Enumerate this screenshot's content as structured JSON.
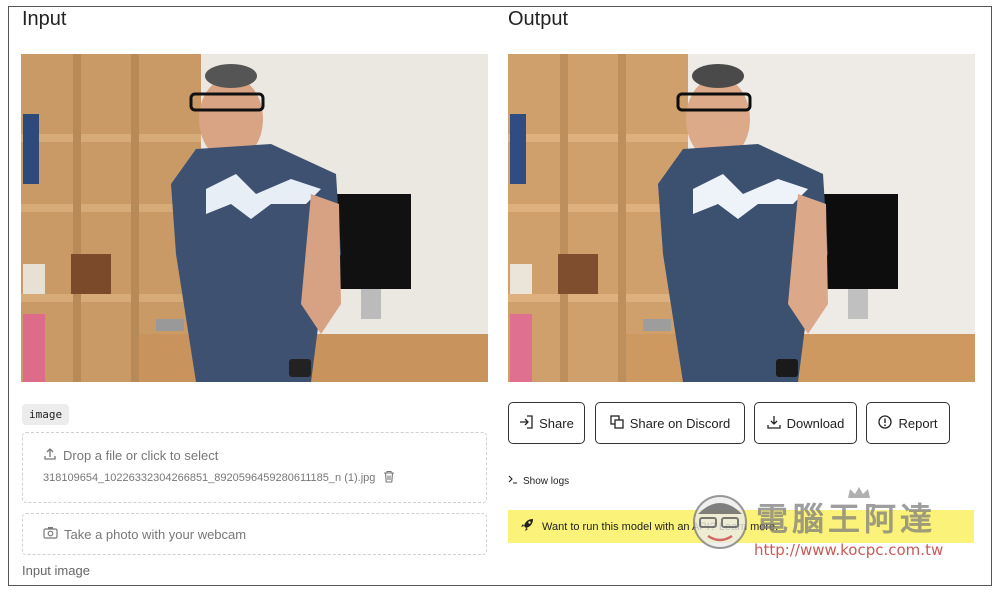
{
  "input": {
    "title": "Input",
    "type_tag": "image",
    "drop_text": "Drop a file or click to select",
    "file_name": "318109654_10226332304266851_8920596459280611185_n (1).jpg",
    "webcam_text": "Take a photo with your webcam",
    "caption": "Input image"
  },
  "output": {
    "title": "Output",
    "buttons": {
      "share": "Share",
      "discord": "Share on Discord",
      "download": "Download",
      "report": "Report"
    },
    "show_logs": "Show logs",
    "api_text": "Want to run this model with an API? Learn more."
  },
  "watermark": {
    "title": "電腦王阿達",
    "url": "http://www.kocpc.com.tw"
  },
  "colors": {
    "api_banner": "#fbf27a",
    "button_border": "#333333"
  }
}
